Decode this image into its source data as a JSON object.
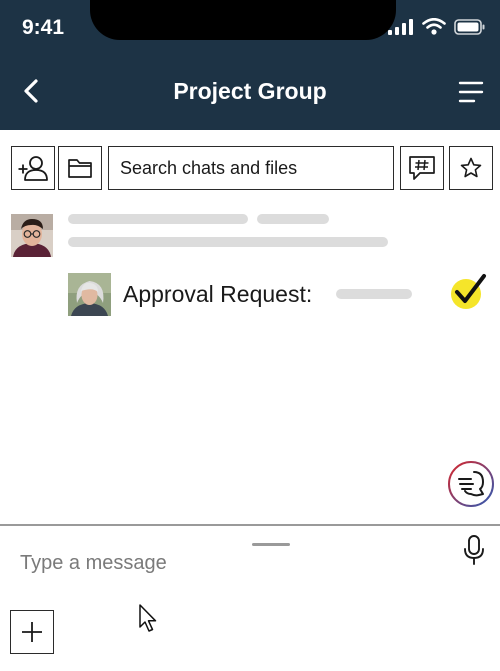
{
  "status_bar": {
    "time": "9:41"
  },
  "header": {
    "title": "Project Group"
  },
  "toolbar": {
    "search_label": "Search chats and files"
  },
  "message": {
    "approval_label": "Approval Request:"
  },
  "composer": {
    "placeholder": "Type a message"
  },
  "colors": {
    "header_bg": "#1d3345",
    "approval_check": "#f5e52a",
    "skeleton": "#dcdcdc"
  }
}
